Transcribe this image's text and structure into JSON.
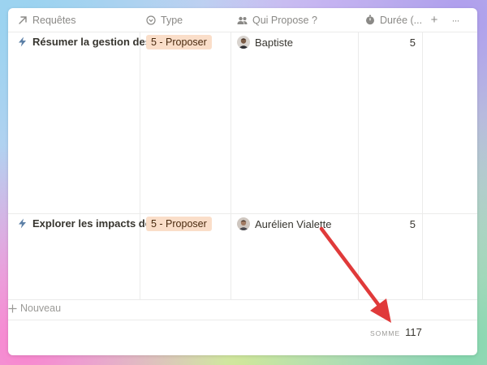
{
  "table": {
    "columns": [
      {
        "label": "Requêtes",
        "icon": "arrow-up-right-icon"
      },
      {
        "label": "Type",
        "icon": "select-circle-icon"
      },
      {
        "label": "Qui Propose ?",
        "icon": "people-icon"
      },
      {
        "label": "Durée (...",
        "icon": "stopwatch-icon"
      }
    ],
    "add_column_label": "+",
    "more_label": "···",
    "rows": [
      {
        "title": "Résumer la gestion des ju",
        "title_icon": "lightning-icon",
        "type": "5 - Proposer",
        "person": "Baptiste",
        "duration": "5"
      },
      {
        "title": "Explorer les impacts de la",
        "title_icon": "lightning-icon",
        "type": "5 - Proposer",
        "person": "Aurélien Vialette",
        "duration": "5"
      }
    ],
    "new_row_label": "Nouveau",
    "sum_label": "SOMME",
    "sum_value": "117"
  },
  "colors": {
    "tag_background": "#fadec9",
    "tag_text": "#49290e",
    "annotation_arrow": "#e03a3a",
    "lightning": "#5b7fa6"
  }
}
